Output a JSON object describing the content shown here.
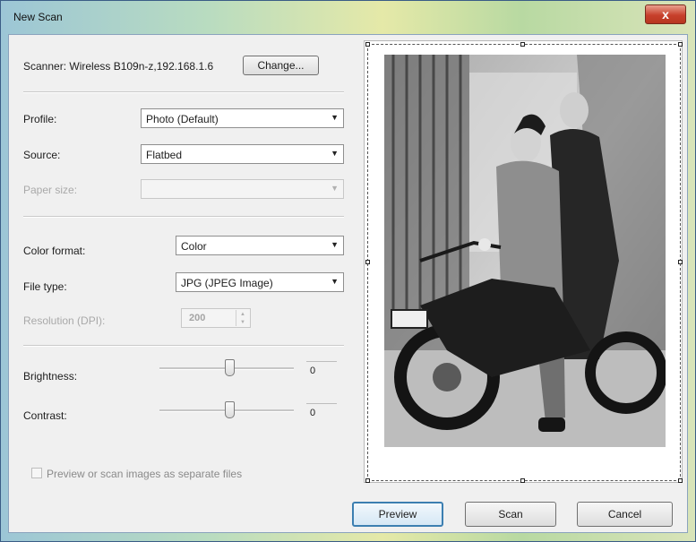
{
  "window": {
    "title": "New Scan",
    "close_glyph": "x"
  },
  "scanner": {
    "label": "Scanner: Wireless B109n-z,192.168.1.6",
    "change_button": "Change..."
  },
  "profile": {
    "label": "Profile:",
    "value": "Photo (Default)"
  },
  "source": {
    "label": "Source:",
    "value": "Flatbed"
  },
  "paper_size": {
    "label": "Paper size:",
    "value": ""
  },
  "color_format": {
    "label": "Color format:",
    "value": "Color"
  },
  "file_type": {
    "label": "File type:",
    "value": "JPG (JPEG Image)"
  },
  "resolution": {
    "label": "Resolution (DPI):",
    "value": "200"
  },
  "brightness": {
    "label": "Brightness:",
    "value": "0",
    "level": 0
  },
  "contrast": {
    "label": "Contrast:",
    "value": "0",
    "level": 0
  },
  "separate_files": {
    "label": "Preview or scan images as separate files",
    "checked": false
  },
  "buttons": {
    "preview": "Preview",
    "scan": "Scan",
    "cancel": "Cancel"
  },
  "icons": {
    "dropdown": "chevron-down-icon",
    "spin": "spin-arrows-icon",
    "close": "close-icon"
  },
  "colors": {
    "default_button_border": "#3c7fb1",
    "close_button": "#c7402c"
  }
}
